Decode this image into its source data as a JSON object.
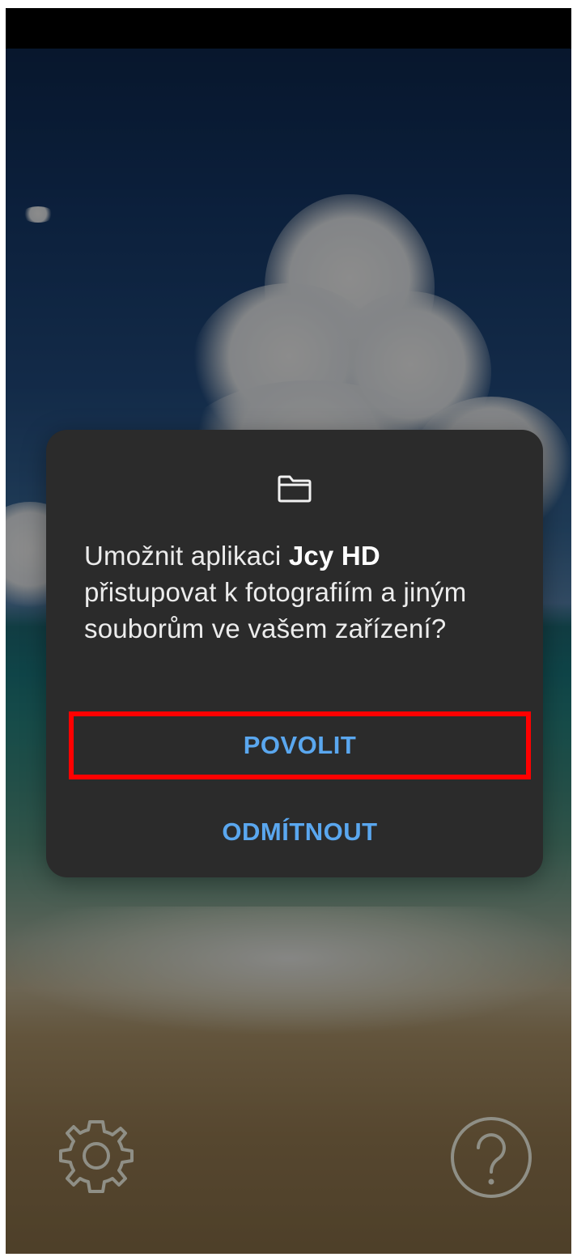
{
  "dialog": {
    "icon": "folder-icon",
    "message_prefix": "Umožnit aplikaci ",
    "app_name": "Jcy HD",
    "message_suffix": " přistupovat k fotografiím a jiným souborům ve vašem zařízení?",
    "allow_label": "POVOLIT",
    "deny_label": "ODMÍTNOUT"
  },
  "background": {
    "settings_icon": "gear-icon",
    "help_icon": "help-circle-icon"
  },
  "colors": {
    "dialog_bg": "#2b2b2b",
    "button_text": "#5aa7ef",
    "highlight": "#ff0000"
  }
}
